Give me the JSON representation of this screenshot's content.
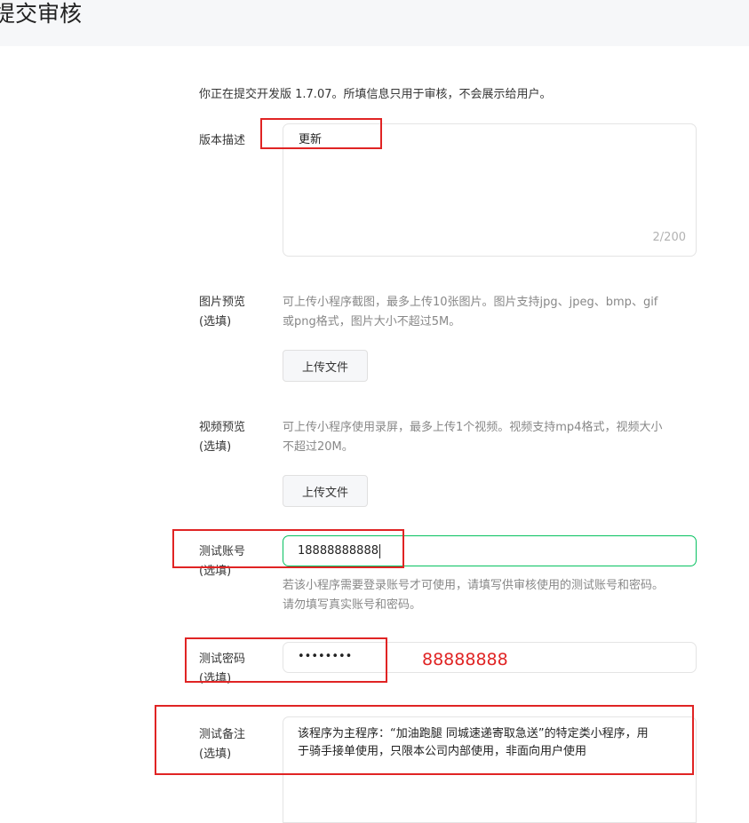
{
  "header": {
    "title": "提交审核"
  },
  "intro": "你正在提交开发版 1.7.07。所填信息只用于审核，不会展示给用户。",
  "version_desc": {
    "label": "版本描述",
    "value": "更新",
    "counter": "2/200"
  },
  "image_preview": {
    "label_line1": "图片预览",
    "label_line2": "(选填)",
    "hint_line1": "可上传小程序截图，最多上传10张图片。图片支持jpg、jpeg、bmp、gif",
    "hint_line2": "或png格式，图片大小不超过5M。",
    "upload_label": "上传文件"
  },
  "video_preview": {
    "label_line1": "视频预览",
    "label_line2": "(选填)",
    "hint_line1": "可上传小程序使用录屏，最多上传1个视频。视频支持mp4格式，视频大小",
    "hint_line2": "不超过20M。",
    "upload_label": "上传文件"
  },
  "test_account": {
    "label_line1": "测试账号",
    "label_line2": "(选填)",
    "value": "18888888888",
    "hint_line1": "若该小程序需要登录账号才可使用，请填写供审核使用的测试账号和密码。",
    "hint_line2": "请勿填写真实账号和密码。"
  },
  "test_password": {
    "label_line1": "测试密码",
    "label_line2": "(选填)",
    "masked_value": "••••••••",
    "annotation": "88888888"
  },
  "test_remark": {
    "label_line1": "测试备注",
    "label_line2": "(选填)",
    "value_line1": "该程序为主程序：“加油跑腿 同城速递寄取急送”的特定类小程序，用",
    "value_line2": "于骑手接单使用，只限本公司内部使用，非面向用户使用"
  },
  "colors": {
    "accent_focus": "#07c160",
    "annotation_red": "#e02424"
  }
}
